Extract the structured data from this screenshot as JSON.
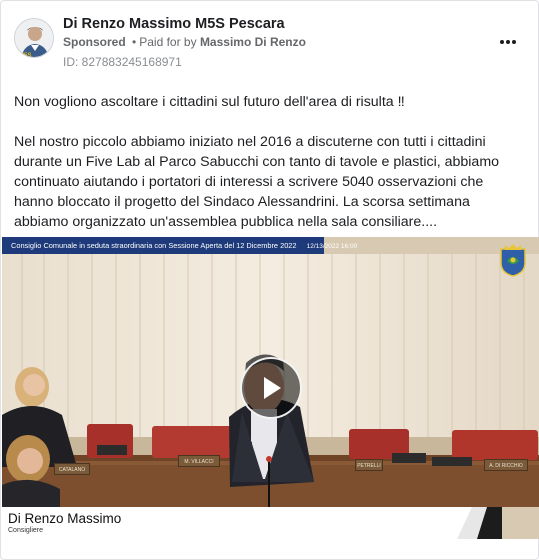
{
  "post": {
    "page_name": "Di Renzo Massimo M5S Pescara",
    "sponsored": "Sponsored",
    "separator": "•",
    "paid_for_prefix": "Paid for by",
    "paid_for_name": "Massimo Di Renzo",
    "ad_id": "ID: 827883245168971",
    "more_icon": "more-options-icon"
  },
  "text": {
    "paragraph_1": "Non vogliono ascoltare i cittadini sul futuro dell'area di risulta ‼",
    "paragraph_2": "Nel nostro piccolo abbiamo iniziato nel 2016 a discuterne con tutti i cittadini durante un Five Lab al Parco Sabucchi con tanto di tavole e plastici, abbiamo continuato aiutando i portatori di interessi a scrivere 5040 osservazioni che hanno bloccato il progetto del Sindaco Alessandrini. La scorsa settimana abbiamo organizzato un'assemblea pubblica nella sala consiliare...."
  },
  "video": {
    "broadcast_title": "Consiglio Comunale in seduta straordinaria con Sessione Aperta del 12 Dicembre 2022",
    "broadcast_datetime": "12/13/2022 16:00",
    "caption_name": "Di Renzo Massimo",
    "caption_role": "Consigliere",
    "nameplates": [
      "CATALANO",
      "M. VILLACCI",
      "PETRELLI",
      "A. DI RICCHIO"
    ],
    "play_icon": "play-icon"
  },
  "colors": {
    "text_primary": "#1c1e21",
    "text_secondary": "#65676b",
    "tv_bar": "#1e3a7a",
    "seat_red": "#a8302a"
  }
}
